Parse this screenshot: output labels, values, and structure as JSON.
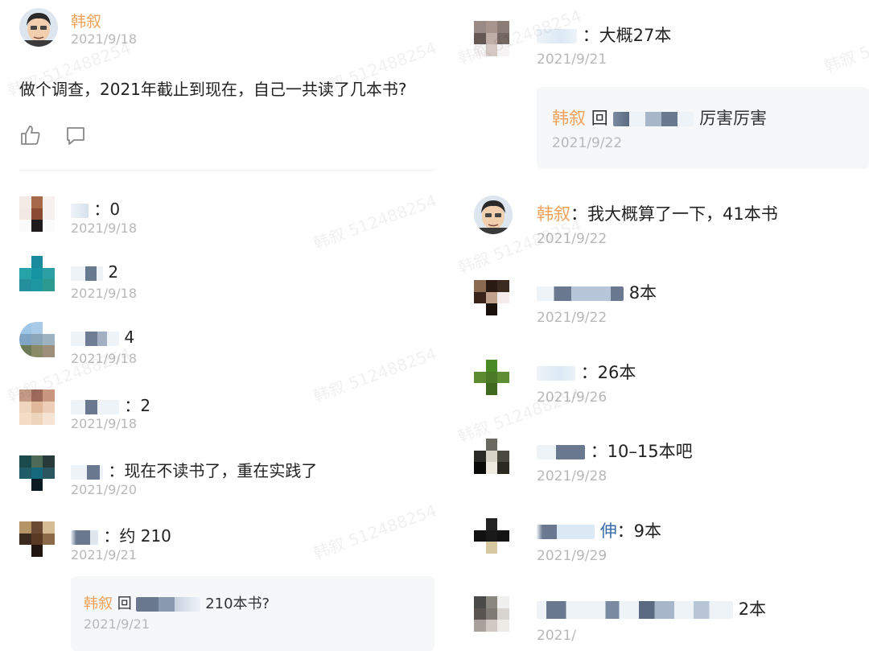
{
  "post": {
    "author": "韩叙",
    "date": "2021/9/18",
    "content": "做个调查，2021年截止到现在，自己一共读了几本书?",
    "actions": [
      "thumb-up-icon",
      "comment-icon"
    ]
  },
  "left_comments": [
    {
      "text": "：0",
      "date": "2021/9/18"
    },
    {
      "text": "2",
      "date": "2021/9/18"
    },
    {
      "text": "4",
      "date": "2021/9/18"
    },
    {
      "text": "：2",
      "date": "2021/9/18"
    },
    {
      "text": "：现在不读书了，重在实践了",
      "date": "2021/9/20"
    },
    {
      "text": "：约 210",
      "date": "2021/9/21"
    }
  ],
  "left_reply": {
    "author": "韩叙",
    "prefix": "回",
    "text": "210本书?",
    "date": "2021/9/21"
  },
  "right_comments": [
    {
      "text": "：大概27本",
      "date": "2021/9/21"
    }
  ],
  "right_reply": {
    "author": "韩叙",
    "prefix": "回",
    "text": "厉害厉害",
    "date": "2021/9/22"
  },
  "author_comment": {
    "author": "韩叙",
    "text": "：我大概算了一下，41本书",
    "date": "2021/9/22"
  },
  "right_more": [
    {
      "text": "8本",
      "date": "2021/9/22"
    },
    {
      "text": "：26本",
      "date": "2021/9/26"
    },
    {
      "text": "：10–15本吧",
      "date": "2021/9/28"
    },
    {
      "text": "：9本",
      "name_tail": "伸",
      "date": "2021/9/29"
    },
    {
      "text": "2本",
      "date": "2021/"
    }
  ],
  "watermark": "韩叙 512488254",
  "colors": {
    "name": "#f0a35c",
    "date": "#b8b8b8",
    "reply_bg": "#f6f7f9"
  }
}
